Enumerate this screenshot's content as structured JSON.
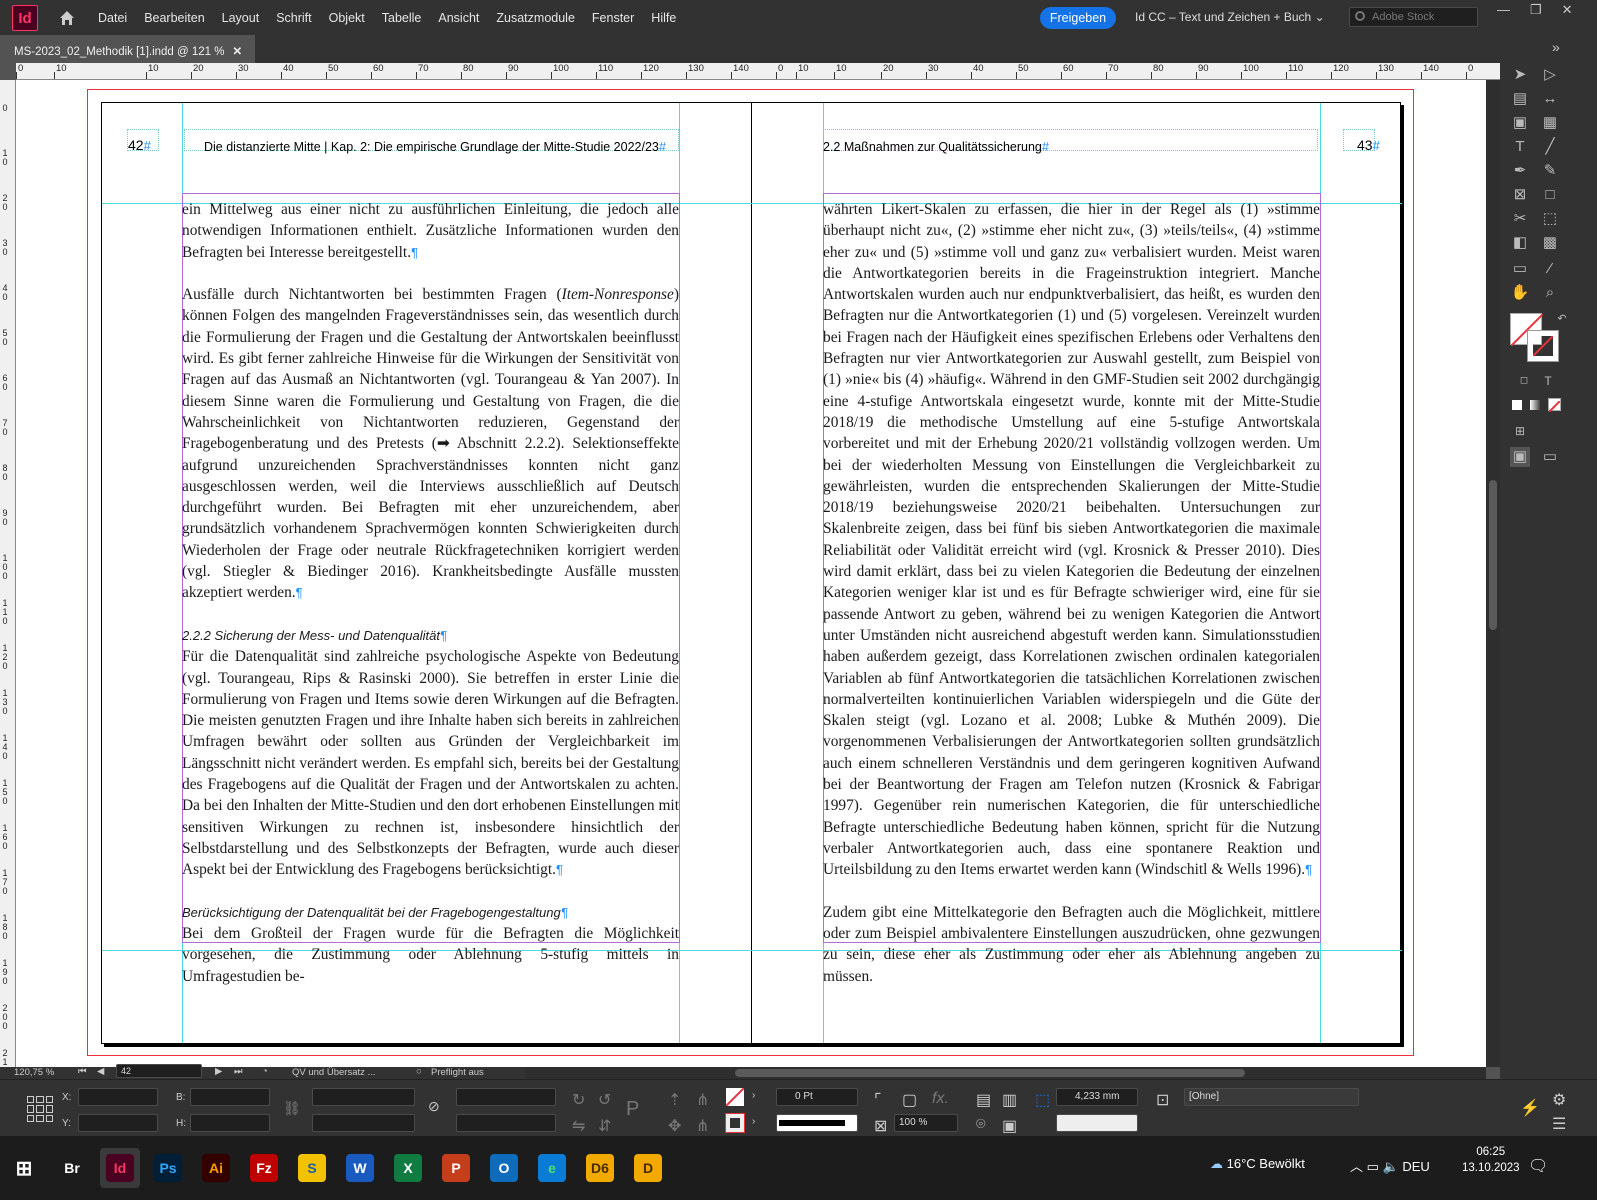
{
  "app": {
    "logo": "Id"
  },
  "menu": [
    "Datei",
    "Bearbeiten",
    "Layout",
    "Schrift",
    "Objekt",
    "Tabelle",
    "Ansicht",
    "Zusatzmodule",
    "Fenster",
    "Hilfe"
  ],
  "share_label": "Freigeben",
  "workspace": "Id CC – Text und Zeichen + Buch",
  "stock_placeholder": "Adobe Stock",
  "doc_tab": "MS-2023_02_Methodik [1].indd @ 121 %",
  "hruler_ticks": [
    "0",
    "10",
    "10",
    "20",
    "30",
    "40",
    "50",
    "60",
    "70",
    "80",
    "90",
    "100",
    "110",
    "120",
    "130",
    "140",
    "0",
    "10",
    "10",
    "20",
    "30",
    "40",
    "50",
    "60",
    "70",
    "80",
    "90",
    "100",
    "110",
    "120",
    "130",
    "140",
    "0"
  ],
  "vruler_ticks": [
    "0",
    "10",
    "20",
    "30",
    "40",
    "50",
    "60",
    "70",
    "80",
    "90",
    "100",
    "110",
    "120",
    "130",
    "140",
    "150",
    "160",
    "170",
    "180",
    "190",
    "200",
    "210"
  ],
  "left_page": {
    "number": "42",
    "running_head": "Die distanzierte Mitte | Kap. 2: Die empirische Grundlage der Mitte-Studie 2022/23",
    "p1": "ein Mittelweg aus einer nicht zu ausführlichen Einleitung, die jedoch alle notwendigen Informationen enthielt. Zusätzliche Informationen wurden den Befragten bei Interesse bereitgestellt.",
    "p2a": "Ausfälle durch Nichtantworten bei bestimmten Fragen (",
    "p2b": "Item-Nonresponse",
    "p2c": ") können Folgen des mangelnden Frageverständnisses sein, das wesentlich durch die Formulierung der Fragen und die Gestaltung der Antwortskalen beeinflusst wird. Es gibt ferner zahlreiche Hinweise für die Wirkungen der Sensitivität von Fragen auf das Ausmaß an Nichtantworten (vgl. Tourangeau & Yan 2007). In diesem Sinne waren die Formulierung und Gestaltung von Fragen, die die Wahrscheinlichkeit von Nichtantworten reduzieren, Gegenstand der Fragebogenberatung und des Pretests (➡ Abschnitt 2.2.2). Selektionseffekte aufgrund unzureichenden Sprachverständnisses konnten nicht ganz ausgeschlossen werden, weil die Interviews ausschließlich auf Deutsch durchgeführt wurden. Bei Befragten mit eher unzureichendem, aber grundsätzlich vorhandenem Sprachvermögen konnten Schwierigkeiten durch Wiederholen der Frage oder neutrale Rückfragetechniken korrigiert werden (vgl. Stiegler & Biedinger 2016). Krankheitsbedingte Ausfälle mussten akzeptiert werden.",
    "h1": "2.2.2  Sicherung der Mess- und Datenqualität",
    "p3": "Für die Datenqualität sind zahlreiche psychologische Aspekte von Bedeutung (vgl. Tourangeau, Rips & Rasinski 2000). Sie betreffen in erster Linie die Formulierung von Fragen und Items sowie deren Wirkungen auf die Befragten. Die meisten genutzten Fragen und ihre Inhalte haben sich bereits in zahlreichen Umfragen bewährt oder sollten aus Gründen der Vergleichbarkeit im Längsschnitt nicht verändert werden. Es empfahl sich, bereits bei der Gestaltung des Fragebogens auf die Qualität der Fragen und der Antwortskalen zu achten. Da bei den Inhalten der Mitte-Studien und den dort erhobenen Einstellungen mit sensitiven Wirkungen zu rechnen ist, insbesondere hinsichtlich der Selbstdarstellung und des Selbstkonzepts der Befragten, wurde auch dieser Aspekt bei der Entwicklung des Fragebogens berücksichtigt.",
    "h2": "Berücksichtigung der Datenqualität bei der Fragebogengestaltung",
    "p4": "Bei dem Großteil der Fragen wurde für die Befragten die Möglichkeit vorgesehen, die Zustimmung oder Ablehnung 5-stufig mittels in Umfragestudien be-"
  },
  "right_page": {
    "number": "43",
    "running_head": "2.2 Maßnahmen zur Qualitätssicherung",
    "p1": "währten Likert-Skalen zu erfassen, die hier in der Regel als (1) »stimme überhaupt nicht zu«, (2) »stimme eher nicht zu«, (3) »teils/teils«, (4) »stimme eher zu« und (5) »stimme voll und ganz zu« verbalisiert wurden. Meist waren die Antwortkategorien bereits in die Frageinstruktion integriert. Manche Antwortskalen wurden auch nur endpunktverbalisiert, das heißt, es wurden den Befragten nur die Antwortkategorien (1) und (5) vorgelesen. Vereinzelt wurden bei Fragen nach der Häufigkeit eines spezifischen Erlebens oder Verhaltens den Befragten nur vier Antwortkategorien zur Auswahl gestellt, zum Beispiel von (1) »nie« bis (4) »häufig«. Während in den GMF-Studien seit 2002 durchgängig eine 4-stufige Antwortskala eingesetzt wurde, konnte mit der Mitte-Studie 2018/19 die methodische Umstellung auf eine 5-stufige Antwortskala vorbereitet und mit der Erhebung 2020/21 vollständig vollzogen werden. Um bei der wiederholten Messung von Einstellungen die Vergleichbarkeit zu gewährleisten, wurden die entsprechenden Skalierungen der Mitte-Studie 2018/19 beziehungsweise 2020/21 beibehalten. Untersuchungen zur Skalenbreite zeigen, dass bei fünf bis sieben Antwortkategorien die maximale Reliabilität oder Validität erreicht wird (vgl. Krosnick & Presser 2010). Dies wird damit erklärt, dass bei zu vielen Kategorien die Bedeutung der einzelnen Kategorien weniger klar ist und es für Befragte schwieriger wird, eine für sie passende Antwort zu geben, während bei zu wenigen Kategorien die Antwort unter Umständen nicht ausreichend abgestuft werden kann. Simulationsstudien haben außerdem gezeigt, dass Korrelationen zwischen ordinalen kategorialen Variablen ab fünf Antwortkategorien die tatsächlichen Korrelationen zwischen normalverteilten kontinuierlichen Variablen widerspiegeln und die Güte der Skalen steigt (vgl. Lozano et al. 2008; Lubke & Muthén 2009). Die vorgenommenen Verbalisierungen der Antwortkategorien sollten grundsätzlich auch einem schnelleren Verständnis und dem geringeren kognitiven Aufwand bei der Beantwortung der Fragen am Telefon nutzen (Krosnick & Fabrigar 1997). Gegenüber rein numerischen Kategorien, die für unterschiedliche Befragte unterschiedliche Bedeutung haben können, spricht für die Nutzung verbaler Antwortkategorien auch, dass eine spontanere Reaktion und Urteilsbildung zu den Items erwartet werden kann (Windschitl & Wells 1996).",
    "p2": "Zudem gibt eine Mittelkategorie den Befragten auch die Möglichkeit, mittlere oder zum Beispiel ambivalentere Einstellungen auszudrücken, ohne gezwungen zu sein, diese eher als Zustimmung oder eher als Ablehnung angeben zu müssen."
  },
  "status": {
    "zoom": "120,75 %",
    "page": "42",
    "style": "QV und Übersatz ...",
    "preflight": "Preflight aus"
  },
  "control": {
    "x_label": "X:",
    "y_label": "Y:",
    "w_label": "B:",
    "h_label": "H:",
    "stroke_weight": "0 Pt",
    "opacity": "100 %",
    "dim": "4,233 mm",
    "style": "[Ohne]"
  },
  "taskbar": {
    "apps": [
      "Br",
      "Id",
      "Ps",
      "Ai",
      "Fz",
      "S",
      "W",
      "X",
      "P",
      "O",
      "e",
      "D6",
      "D"
    ],
    "weather": "16°C  Bewölkt",
    "lang": "DEU",
    "time": "06:25",
    "date": "13.10.2023"
  },
  "colors": {
    "indesign": "#ff3366",
    "share": "#1473e6",
    "guide": "#4adbe0",
    "margin": "#b36ad9",
    "bleed": "#e7323c"
  }
}
